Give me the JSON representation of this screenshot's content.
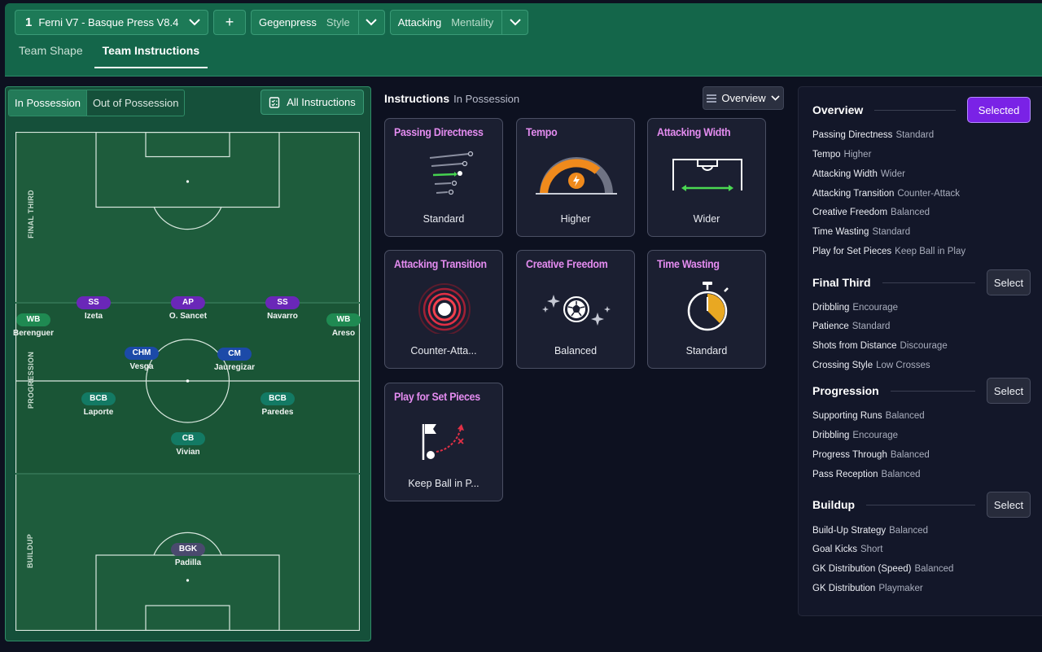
{
  "header": {
    "tactic_number": "1",
    "tactic_name": "Ferni V7 - Basque Press V8.4",
    "add_label": "+",
    "style_value": "Gegenpress",
    "style_label": "Style",
    "mentality_value": "Attacking",
    "mentality_label": "Mentality",
    "tabs": [
      {
        "label": "Team Shape",
        "active": false
      },
      {
        "label": "Team Instructions",
        "active": true
      }
    ]
  },
  "pitch": {
    "toggle": {
      "in_possession": "In Possession",
      "out_of_possession": "Out of Possession"
    },
    "all_instructions_label": "All Instructions",
    "zones": {
      "final_third": "FINAL THIRD",
      "progression": "PROGRESSION",
      "buildup": "BUILDUP"
    },
    "players": [
      {
        "role": "SS",
        "name": "Izeta",
        "color": "#6a27b8"
      },
      {
        "role": "AP",
        "name": "O. Sancet",
        "color": "#6a27b8"
      },
      {
        "role": "SS",
        "name": "Navarro",
        "color": "#6a27b8"
      },
      {
        "role": "WB",
        "name": "Berenguer",
        "color": "#1f8a52"
      },
      {
        "role": "WB",
        "name": "Areso",
        "color": "#1f8a52"
      },
      {
        "role": "CHM",
        "name": "Vesga",
        "color": "#1c4aa8"
      },
      {
        "role": "CM",
        "name": "Jauregizar",
        "color": "#1c4aa8"
      },
      {
        "role": "BCB",
        "name": "Laporte",
        "color": "#137a64"
      },
      {
        "role": "BCB",
        "name": "Paredes",
        "color": "#137a64"
      },
      {
        "role": "CB",
        "name": "Vivian",
        "color": "#137a64"
      },
      {
        "role": "BGK",
        "name": "Padilla",
        "color": "#4a4a6e"
      }
    ]
  },
  "instructions": {
    "title": "Instructions",
    "subtitle": "In Possession",
    "view_dropdown": "Overview",
    "cards": [
      {
        "title": "Passing Directness",
        "value": "Standard",
        "icon": "passing-directness-icon"
      },
      {
        "title": "Tempo",
        "value": "Higher",
        "icon": "tempo-gauge-icon"
      },
      {
        "title": "Attacking Width",
        "value": "Wider",
        "icon": "attacking-width-icon"
      },
      {
        "title": "Attacking Transition",
        "value": "Counter-Atta...",
        "icon": "attacking-transition-icon"
      },
      {
        "title": "Creative Freedom",
        "value": "Balanced",
        "icon": "creative-freedom-icon"
      },
      {
        "title": "Time Wasting",
        "value": "Standard",
        "icon": "stopwatch-icon"
      },
      {
        "title": "Play for Set Pieces",
        "value": "Keep Ball in P...",
        "icon": "set-pieces-icon"
      }
    ]
  },
  "overview": {
    "sections": [
      {
        "title": "Overview",
        "button": "Selected",
        "items": [
          {
            "label": "Passing Directness",
            "value": "Standard"
          },
          {
            "label": "Tempo",
            "value": "Higher"
          },
          {
            "label": "Attacking Width",
            "value": "Wider"
          },
          {
            "label": "Attacking Transition",
            "value": "Counter-Attack"
          },
          {
            "label": "Creative Freedom",
            "value": "Balanced"
          },
          {
            "label": "Time Wasting",
            "value": "Standard"
          },
          {
            "label": "Play for Set Pieces",
            "value": "Keep Ball in Play"
          }
        ]
      },
      {
        "title": "Final Third",
        "button": "Select",
        "items": [
          {
            "label": "Dribbling",
            "value": "Encourage"
          },
          {
            "label": "Patience",
            "value": "Standard"
          },
          {
            "label": "Shots from Distance",
            "value": "Discourage"
          },
          {
            "label": "Crossing Style",
            "value": "Low Crosses"
          }
        ]
      },
      {
        "title": "Progression",
        "button": "Select",
        "items": [
          {
            "label": "Supporting Runs",
            "value": "Balanced"
          },
          {
            "label": "Dribbling",
            "value": "Encourage"
          },
          {
            "label": "Progress Through",
            "value": "Balanced"
          },
          {
            "label": "Pass Reception",
            "value": "Balanced"
          }
        ]
      },
      {
        "title": "Buildup",
        "button": "Select",
        "items": [
          {
            "label": "Build-Up Strategy",
            "value": "Balanced"
          },
          {
            "label": "Goal Kicks",
            "value": "Short"
          },
          {
            "label": "GK Distribution (Speed)",
            "value": "Balanced"
          },
          {
            "label": "GK Distribution",
            "value": "Playmaker"
          }
        ]
      }
    ]
  }
}
